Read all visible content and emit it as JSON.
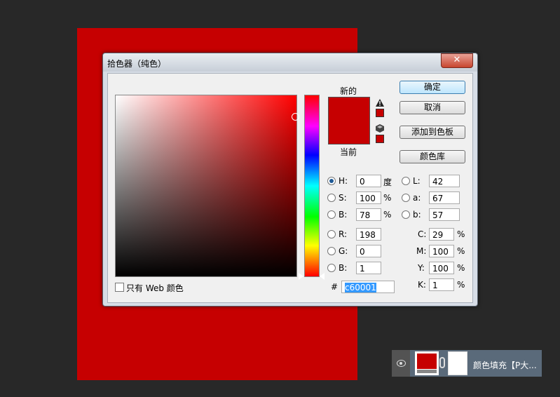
{
  "dialog": {
    "title": "拾色器（纯色）",
    "close": "✕",
    "new_label": "新的",
    "current_label": "当前",
    "new_color": "#c60001",
    "current_color": "#c60001",
    "gamut_warning_icon": "warning-triangle-icon",
    "web_safe_icon": "cube-icon",
    "buttons": {
      "ok": "确定",
      "cancel": "取消",
      "add_swatch": "添加到色板",
      "color_libraries": "颜色库"
    },
    "fields": {
      "H": {
        "label": "H:",
        "value": "0",
        "unit": "度"
      },
      "S": {
        "label": "S:",
        "value": "100",
        "unit": "%"
      },
      "B": {
        "label": "B:",
        "value": "78",
        "unit": "%"
      },
      "R": {
        "label": "R:",
        "value": "198"
      },
      "G": {
        "label": "G:",
        "value": "0"
      },
      "Bl": {
        "label": "B:",
        "value": "1"
      },
      "L": {
        "label": "L:",
        "value": "42"
      },
      "a": {
        "label": "a:",
        "value": "67"
      },
      "b": {
        "label": "b:",
        "value": "57"
      },
      "C": {
        "label": "C:",
        "value": "29",
        "unit": "%"
      },
      "M": {
        "label": "M:",
        "value": "100",
        "unit": "%"
      },
      "Y": {
        "label": "Y:",
        "value": "100",
        "unit": "%"
      },
      "K": {
        "label": "K:",
        "value": "1",
        "unit": "%"
      }
    },
    "hex_label": "#",
    "hex_value": "c60001",
    "web_only_label": "只有 Web 颜色",
    "selected_mode": "H"
  },
  "layer": {
    "name": "颜色填充【P大...",
    "fill_color": "#c60001"
  },
  "colors": {
    "accent": "#c60001",
    "background": "#282828"
  }
}
